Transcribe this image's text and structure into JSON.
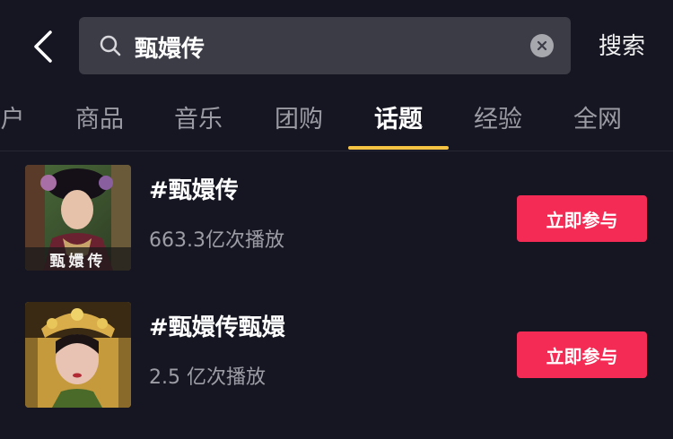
{
  "header": {
    "back_icon": "chevron-left-icon",
    "search": {
      "value": "甄嬛传",
      "search_icon": "search-icon",
      "clear_icon": "clear-icon"
    },
    "search_button_label": "搜索"
  },
  "tabs": [
    {
      "label": "户",
      "active": false
    },
    {
      "label": "商品",
      "active": false
    },
    {
      "label": "音乐",
      "active": false
    },
    {
      "label": "团购",
      "active": false
    },
    {
      "label": "话题",
      "active": true
    },
    {
      "label": "经验",
      "active": false
    },
    {
      "label": "全网",
      "active": false
    }
  ],
  "results": [
    {
      "title": "#甄嬛传",
      "plays": "663.3亿次播放",
      "thumb_caption": "甄嬛传",
      "join_label": "立即参与"
    },
    {
      "title": "#甄嬛传甄嬛",
      "plays": "2.5 亿次播放",
      "join_label": "立即参与"
    }
  ],
  "colors": {
    "background": "#161622",
    "search_box": "#3b3c46",
    "active_indicator": "#f6c342",
    "join_button": "#f42b55"
  }
}
